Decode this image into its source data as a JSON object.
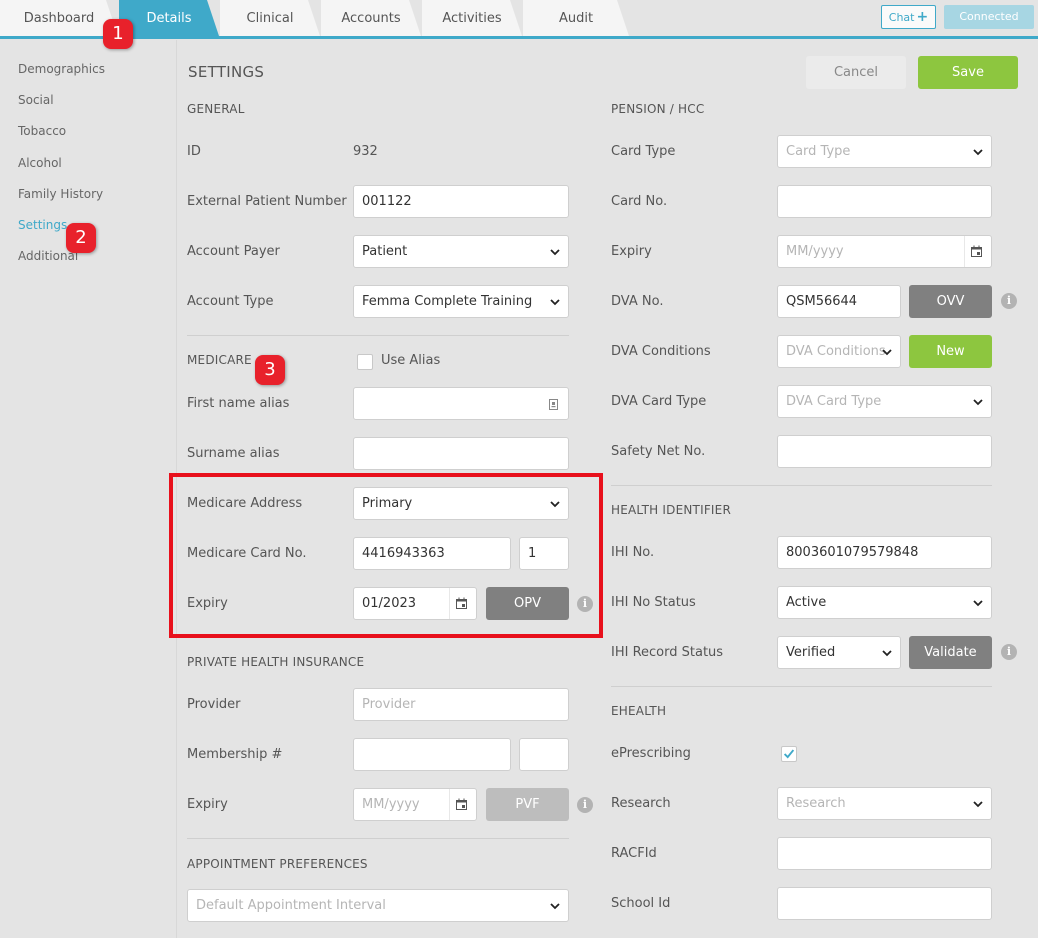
{
  "tabs": [
    {
      "label": "Dashboard"
    },
    {
      "label": "Details"
    },
    {
      "label": "Clinical"
    },
    {
      "label": "Accounts"
    },
    {
      "label": "Activities"
    },
    {
      "label": "Audit"
    }
  ],
  "header": {
    "chat_label": "Chat",
    "chat_plus": "+",
    "connected_label": "Connected"
  },
  "sidebar": {
    "items": [
      {
        "label": "Demographics"
      },
      {
        "label": "Social"
      },
      {
        "label": "Tobacco"
      },
      {
        "label": "Alcohol"
      },
      {
        "label": "Family History"
      },
      {
        "label": "Settings"
      },
      {
        "label": "Additional"
      }
    ]
  },
  "main": {
    "title": "SETTINGS",
    "cancel_label": "Cancel",
    "save_label": "Save"
  },
  "general": {
    "heading": "GENERAL",
    "id_label": "ID",
    "id_value": "932",
    "external_label": "External Patient Number",
    "external_value": "001122",
    "payer_label": "Account Payer",
    "payer_value": "Patient",
    "type_label": "Account Type",
    "type_value": "Femma Complete Training"
  },
  "medicare": {
    "heading": "MEDICARE",
    "use_alias_label": "Use Alias",
    "first_alias_label": "First name alias",
    "first_alias_value": "",
    "surname_alias_label": "Surname alias",
    "surname_alias_value": "",
    "address_label": "Medicare Address",
    "address_value": "Primary",
    "card_label": "Medicare Card No.",
    "card_value": "4416943363",
    "irn_value": "1",
    "expiry_label": "Expiry",
    "expiry_value": "01/2023",
    "opv_label": "OPV"
  },
  "private_health": {
    "heading": "PRIVATE HEALTH INSURANCE",
    "provider_label": "Provider",
    "provider_placeholder": "Provider",
    "membership_label": "Membership #",
    "expiry_label": "Expiry",
    "expiry_placeholder": "MM/yyyy",
    "pvf_label": "PVF"
  },
  "appointment": {
    "heading": "APPOINTMENT PREFERENCES",
    "interval_placeholder": "Default Appointment Interval"
  },
  "pension": {
    "heading": "PENSION / HCC",
    "card_type_label": "Card Type",
    "card_type_placeholder": "Card Type",
    "card_no_label": "Card No.",
    "expiry_label": "Expiry",
    "expiry_placeholder": "MM/yyyy",
    "dva_no_label": "DVA No.",
    "dva_no_value": "QSM56644",
    "ovv_label": "OVV",
    "dva_conditions_label": "DVA Conditions",
    "dva_conditions_placeholder": "DVA Conditions",
    "new_label": "New",
    "dva_card_type_label": "DVA Card Type",
    "dva_card_type_placeholder": "DVA Card Type",
    "safety_net_label": "Safety Net No."
  },
  "health_identifier": {
    "heading": "HEALTH IDENTIFIER",
    "ihi_label": "IHI No.",
    "ihi_value": "8003601079579848",
    "ihi_status_label": "IHI No Status",
    "ihi_status_value": "Active",
    "ihi_record_label": "IHI Record Status",
    "ihi_record_value": "Verified",
    "validate_label": "Validate"
  },
  "ehealth": {
    "heading": "EHEALTH",
    "eprescribing_label": "ePrescribing",
    "eprescribing_checked": true,
    "research_label": "Research",
    "research_placeholder": "Research",
    "racfid_label": "RACFId",
    "school_label": "School Id"
  },
  "annotations": [
    "1",
    "2",
    "3"
  ],
  "info_glyph": "i",
  "colors": {
    "accent": "#3fa9c9",
    "green": "#8dc63f",
    "annotation_red": "#e8212b",
    "button_grey": "#808080"
  }
}
